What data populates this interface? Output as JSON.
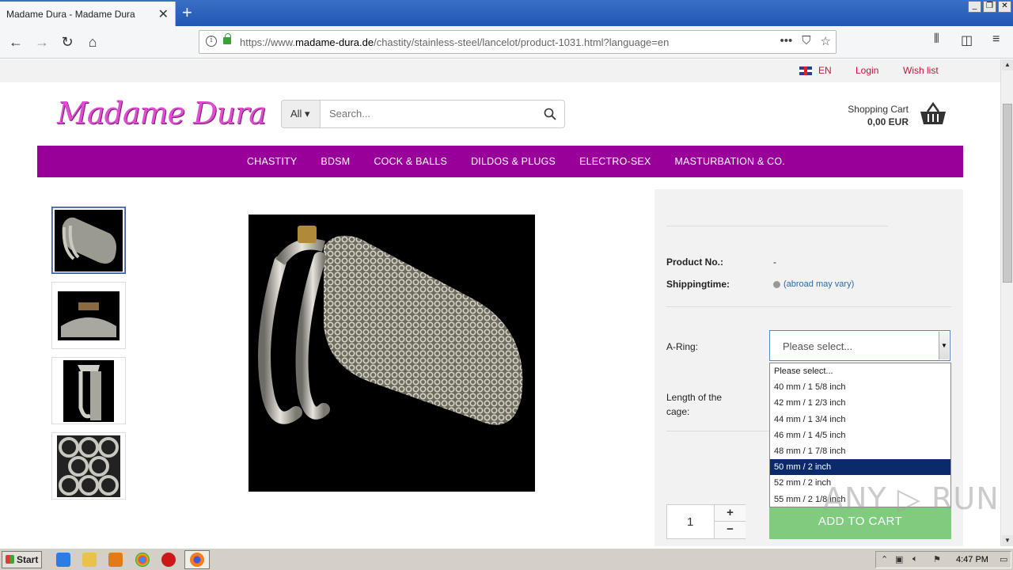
{
  "browser": {
    "tab_title": "Madame Dura - Madame Dura",
    "tab_close": "✕",
    "new_tab": "+",
    "url_prefix": "https://www.",
    "url_domain": "madame-dura.de",
    "url_path": "/chastity/stainless-steel/lancelot/product-1031.html?language=en",
    "url_more": "•••"
  },
  "topbar": {
    "language": "EN",
    "login": "Login",
    "wishlist": "Wish list"
  },
  "header": {
    "logo": "Madame Dura",
    "search_category": "All ▾",
    "search_placeholder": "Search...",
    "cart_label": "Shopping Cart",
    "cart_amount": "0,00 EUR"
  },
  "menu": {
    "items": [
      "CHASTITY",
      "BDSM",
      "COCK & BALLS",
      "DILDOS & PLUGS",
      "ELECTRO-SEX",
      "MASTURBATION & CO."
    ]
  },
  "product": {
    "product_no_label": "Product No.:",
    "product_no_value": "-",
    "shipping_label": "Shippingtime:",
    "shipping_note": "(abroad may vary)",
    "aring_label": "A-Ring:",
    "aring_selected": "Please select...",
    "length_label": "Length of the cage:",
    "aring_options": [
      "Please select...",
      "40 mm / 1 5/8 inch",
      "42 mm / 1 2/3 inch",
      "44 mm / 1 3/4 inch",
      "46 mm / 1 4/5 inch",
      "48 mm / 1 7/8 inch",
      "50 mm / 2 inch",
      "52 mm / 2 inch",
      "55 mm / 2 1/8 inch"
    ],
    "highlighted_option": "50 mm / 2 inch",
    "quantity": "1",
    "qty_plus": "+",
    "qty_minus": "−",
    "add_to_cart": "ADD TO CART"
  },
  "taskbar": {
    "start": "Start",
    "clock": "4:47 PM"
  },
  "watermark": "ANY ▷ RUN",
  "colors": {
    "menu_bg": "#990099",
    "logo": "#e24bd3",
    "link_red": "#c0143c",
    "add_to_cart": "#7fcc7f",
    "dropdown_highlight": "#0b2a6b"
  }
}
